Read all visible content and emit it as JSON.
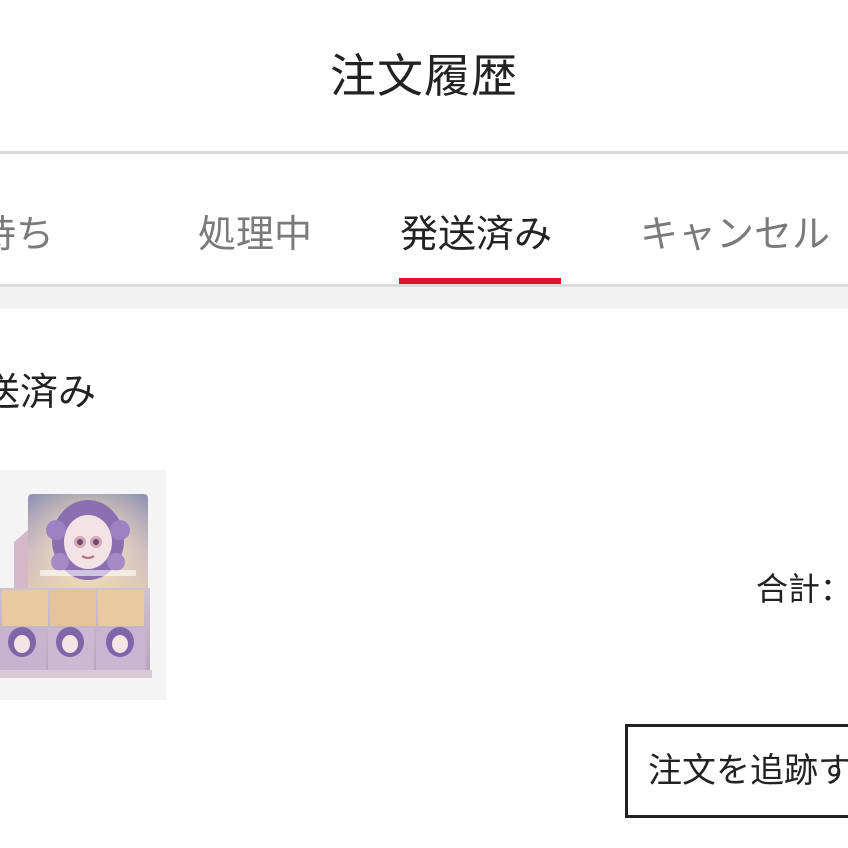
{
  "header": {
    "title": "注文履歴"
  },
  "tabs": [
    {
      "label": "い待ち",
      "active": false
    },
    {
      "label": "処理中",
      "active": false
    },
    {
      "label": "発送済み",
      "active": true
    },
    {
      "label": "キャンセル",
      "active": false
    }
  ],
  "colors": {
    "accent": "#e0152b",
    "text": "#222222",
    "inactive_text": "#7a7a7a",
    "divider": "#d9d9d9",
    "band": "#f2f2f2"
  },
  "order": {
    "status": "送済み",
    "total_label": "合計：",
    "track_button_label": "注文を追跡す",
    "product_image_icon": "blind-box-product-image"
  }
}
